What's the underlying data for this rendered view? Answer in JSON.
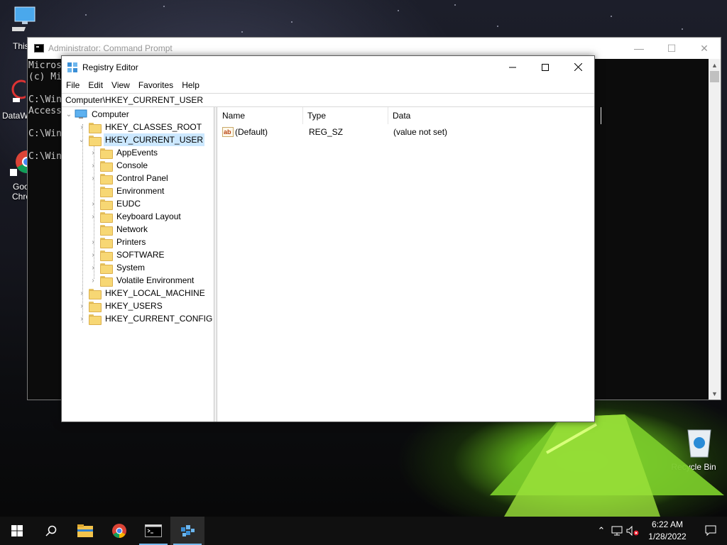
{
  "desktop": {
    "icons": [
      {
        "label": "This"
      },
      {
        "label": "DataW"
      },
      {
        "label": "Goo"
      },
      {
        "label": "Chro"
      },
      {
        "label": "Recycle Bin"
      }
    ]
  },
  "cmd": {
    "title": "Administrator: Command Prompt",
    "lines": [
      "Micros",
      "(c) Mi",
      "",
      "C:\\Win",
      "Access",
      "",
      "C:\\Win",
      "",
      "C:\\Win"
    ],
    "colors": {
      "background": "#0c0c0c",
      "text": "#cccccc"
    }
  },
  "regedit": {
    "title": "Registry Editor",
    "menu": [
      "File",
      "Edit",
      "View",
      "Favorites",
      "Help"
    ],
    "address": "Computer\\HKEY_CURRENT_USER",
    "tree": {
      "root": "Computer",
      "hives": [
        "HKEY_CLASSES_ROOT",
        "HKEY_CURRENT_USER",
        "HKEY_LOCAL_MACHINE",
        "HKEY_USERS",
        "HKEY_CURRENT_CONFIG"
      ],
      "selected": "HKEY_CURRENT_USER",
      "hkcu_children": [
        {
          "label": "AppEvents",
          "expandable": true
        },
        {
          "label": "Console",
          "expandable": true
        },
        {
          "label": "Control Panel",
          "expandable": true
        },
        {
          "label": "Environment",
          "expandable": false
        },
        {
          "label": "EUDC",
          "expandable": true
        },
        {
          "label": "Keyboard Layout",
          "expandable": true
        },
        {
          "label": "Network",
          "expandable": false
        },
        {
          "label": "Printers",
          "expandable": true
        },
        {
          "label": "SOFTWARE",
          "expandable": true
        },
        {
          "label": "System",
          "expandable": true
        },
        {
          "label": "Volatile Environment",
          "expandable": true
        }
      ]
    },
    "columns": [
      "Name",
      "Type",
      "Data"
    ],
    "values": [
      {
        "name": "(Default)",
        "type": "REG_SZ",
        "data": "(value not set)"
      }
    ],
    "selection_color": "#cce8ff"
  },
  "taskbar": {
    "items": [
      "start-icon",
      "search-icon",
      "file-explorer-icon",
      "chrome-icon",
      "command-prompt-icon",
      "registry-editor-icon"
    ],
    "time": "6:22 AM",
    "date": "1/28/2022",
    "accent": "#76b9ed"
  }
}
